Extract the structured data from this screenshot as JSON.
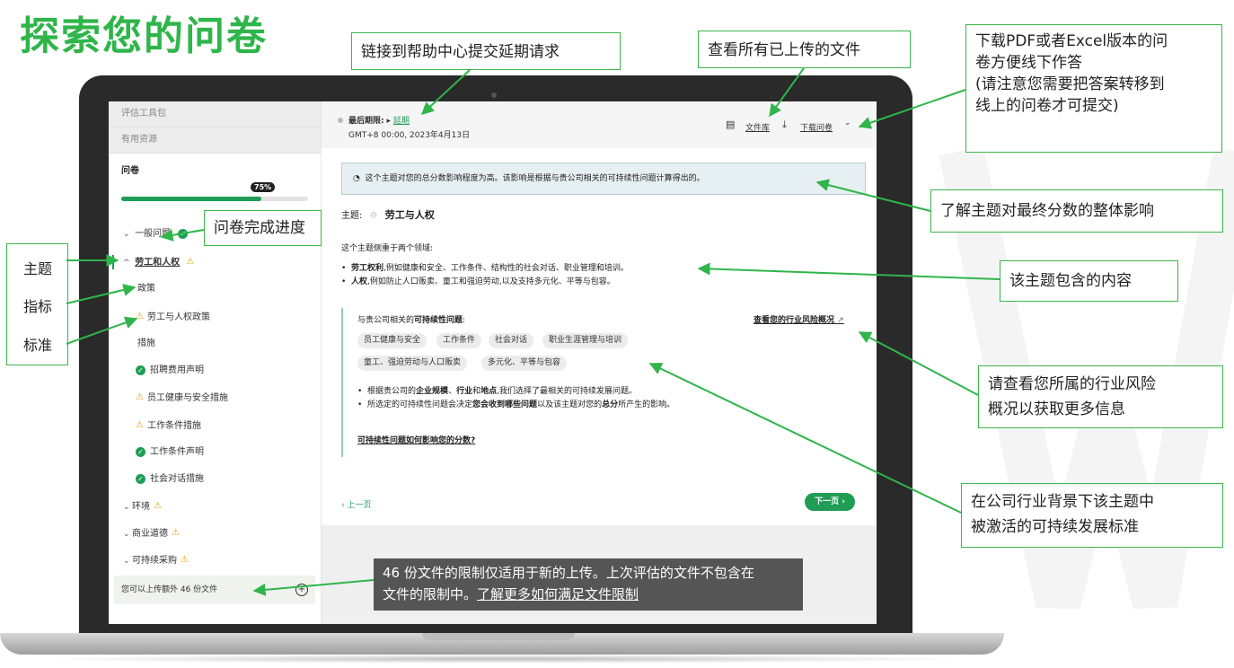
{
  "page_title": "探索您的问卷",
  "sidebar": {
    "nav": [
      "评估工具包",
      "有用资源"
    ],
    "section_label": "问卷",
    "progress_label": "75%",
    "progress_value": 0.75,
    "items": {
      "general": "一般问题",
      "labor": "劳工和人权",
      "policy": "政策",
      "labor_policy": "劳工与人权政策",
      "measures": "措施",
      "recruit_fee": "招聘费用声明",
      "health_safety": "员工健康与安全措施",
      "work_cond": "工作条件措施",
      "work_cond_stmt": "工作条件声明",
      "social_dialog": "社会对话措施",
      "environment": "环境",
      "ethics": "商业道德",
      "procurement": "可持续采购"
    },
    "upload": "您可以上传额外 46 份文件"
  },
  "header": {
    "deadline_label": "最后期限:",
    "extend_link": "延期",
    "deadline_time": "GMT+8 00:00, 2023年4月13日",
    "library_link": "文件库",
    "download_link": "下载问卷"
  },
  "main": {
    "impact_banner": "这个主题对您的总分数影响程度为高。该影响是根据与贵公司相关的可持续性问题计算得出的。",
    "theme_prefix": "主题:",
    "theme_name": "劳工与人权",
    "focus_intro": "这个主题侧重于两个领域:",
    "bullet1_bold": "劳工权利",
    "bullet1_rest": ",例如健康和安全、工作条件、结构性的社会对话、职业管理和培训。",
    "bullet2_bold": "人权",
    "bullet2_rest": ",例如防止人口贩卖、童工和强迫劳动,以及支持多元化、平等与包容。",
    "issues_prefix": "与贵公司相关的",
    "issues_bold": "可持续性问题",
    "issues_suffix": ":",
    "risk_link": "查看您的行业风险概况",
    "tags": [
      "员工健康与安全",
      "工作条件",
      "社会对话",
      "职业生涯管理与培训",
      "童工、强迫劳动与人口贩卖",
      "多元化、平等与包容"
    ],
    "note1_a": "根据贵公司的",
    "note1_b1": "企业规模",
    "note1_sep1": "、",
    "note1_b2": "行业",
    "note1_sep2": "和",
    "note1_b3": "地点",
    "note1_c": ",我们选择了最相关的可持续发展问题。",
    "note2_a": "所选定的可持续性问题会决定",
    "note2_b1": "您会收到哪些问题",
    "note2_c": "以及该主题对您的",
    "note2_b2": "总分",
    "note2_d": "所产生的影响。",
    "score_link": "可持续性问题如何影响您的分数?",
    "prev": "‹ 上一页",
    "next": "下一页 ›"
  },
  "tooltip": {
    "line1": "46 份文件的限制仅适用于新的上传。上次评估的文件不包含在",
    "line2": "文件的限制中。",
    "link": "了解更多如何满足文件限制"
  },
  "callouts": {
    "help": "链接到帮助中心提交延期请求",
    "files": "查看所有已上传的文件",
    "download": [
      "下载PDF或者Excel版本的问",
      "卷方便线下作答",
      "(请注意您需要把答案转移到",
      "线上的问卷才可提交)"
    ],
    "impact": "了解主题对最终分数的整体影响",
    "progress": "问卷完成进度",
    "content": "该主题包含的内容",
    "risk": [
      "请查看您所属的行业风险",
      "概况以获取更多信息"
    ],
    "standards": [
      "在公司行业背景下该主题中",
      "被激活的可持续发展标准"
    ],
    "left_labels": [
      "主题",
      "指标",
      "标准"
    ]
  },
  "colors": {
    "accent_green": "#2fb54a",
    "button_green": "#1f9d55",
    "warning": "#e6a000"
  }
}
